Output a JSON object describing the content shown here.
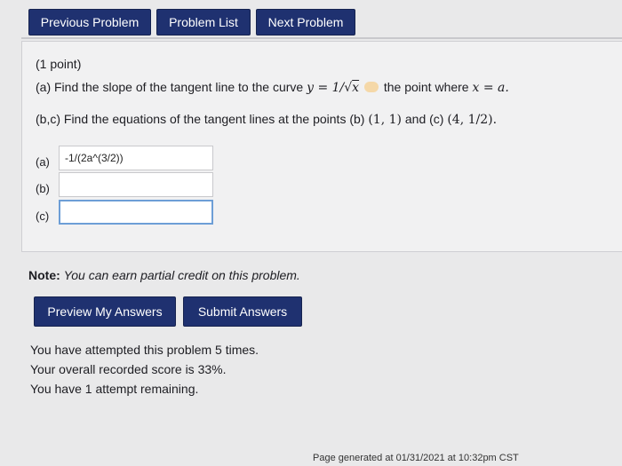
{
  "nav": {
    "previous_label": "Previous Problem",
    "list_label": "Problem List",
    "next_label": "Next Problem"
  },
  "problem": {
    "points": "(1 point)",
    "part_a": {
      "prefix": "(a) Find the slope of the tangent line to the curve",
      "equation_lhs": "y = 1/",
      "equation_sqrt": "x",
      "suffix": "the point where",
      "condition": "x = a."
    },
    "part_bc": {
      "prefix": "(b,c) Find the equations of the tangent lines at the points (b)",
      "point_b": "(1, 1)",
      "and_c": "and (c)",
      "point_c": "(4, 1/2)."
    }
  },
  "answers": {
    "a": {
      "label": "(a)",
      "value": "-1/(2a^(3/2))"
    },
    "b": {
      "label": "(b)",
      "value": ""
    },
    "c": {
      "label": "(c)",
      "value": ""
    }
  },
  "note": {
    "bold": "Note:",
    "italic": "You can earn partial credit on this problem."
  },
  "actions": {
    "preview_label": "Preview My Answers",
    "submit_label": "Submit Answers"
  },
  "status": {
    "attempts": "You have attempted this problem 5 times.",
    "score": "Your overall recorded score is 33%.",
    "remaining": "You have 1 attempt remaining."
  },
  "footer": {
    "generated": "Page generated at 01/31/2021 at 10:32pm CST"
  },
  "colors": {
    "button_bg": "#1f3170",
    "focus_border": "#6d9ed6"
  }
}
